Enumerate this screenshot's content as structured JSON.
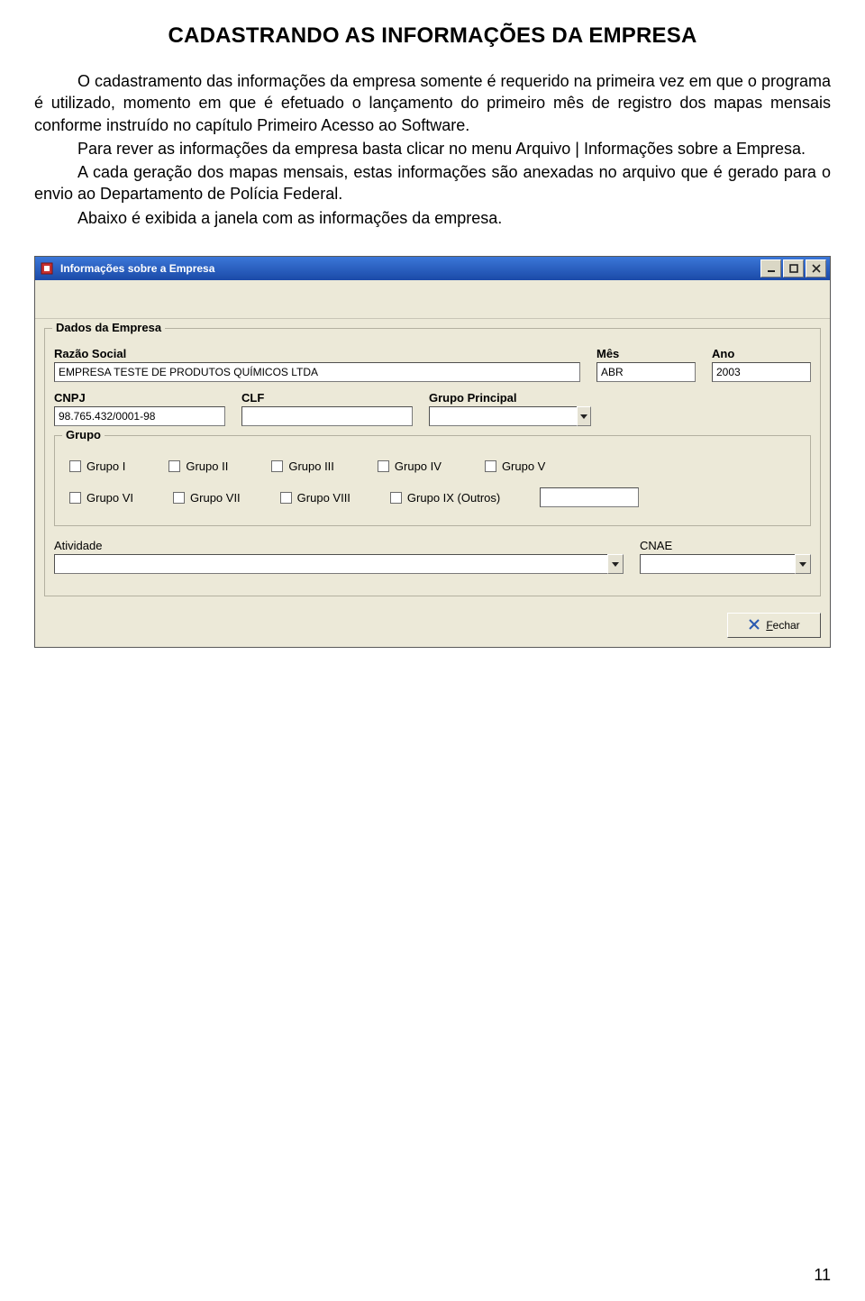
{
  "doc": {
    "title": "CADASTRANDO AS INFORMAÇÕES DA EMPRESA",
    "p1": "O cadastramento das informações da empresa somente é requerido na primeira vez em que o programa é utilizado, momento em que é efetuado o lançamento do primeiro mês de registro dos mapas mensais conforme instruído no capítulo Primeiro Acesso ao Software.",
    "p2": "Para rever as informações da empresa basta clicar no menu Arquivo | Informações sobre a Empresa.",
    "p3": "A cada geração dos mapas mensais, estas informações são anexadas no arquivo que é gerado para o envio ao Departamento de Polícia Federal.",
    "p4": "Abaixo é exibida a janela com as informações da empresa.",
    "page_number": "11"
  },
  "window": {
    "title": "Informações sobre a Empresa",
    "close_button_text": "echar",
    "close_button_mnemonic": "F"
  },
  "form": {
    "fieldset_dados_legend": "Dados da Empresa",
    "labels": {
      "razao_social": "Razão Social",
      "mes": "Mês",
      "ano": "Ano",
      "cnpj": "CNPJ",
      "clf": "CLF",
      "grupo_principal": "Grupo Principal",
      "atividade": "Atividade",
      "cnae": "CNAE"
    },
    "values": {
      "razao_social": "EMPRESA TESTE DE PRODUTOS QUÍMICOS LTDA",
      "mes": "ABR",
      "ano": "2003",
      "cnpj": "98.765.432/0001-98",
      "clf": "",
      "grupo_principal": "",
      "atividade": "",
      "cnae": "",
      "grupo_ix_extra": ""
    },
    "fieldset_grupo_legend": "Grupo",
    "grupos_row1": [
      "Grupo I",
      "Grupo II",
      "Grupo III",
      "Grupo IV",
      "Grupo V"
    ],
    "grupos_row2": [
      "Grupo VI",
      "Grupo VII",
      "Grupo VIII",
      "Grupo IX (Outros)"
    ]
  }
}
